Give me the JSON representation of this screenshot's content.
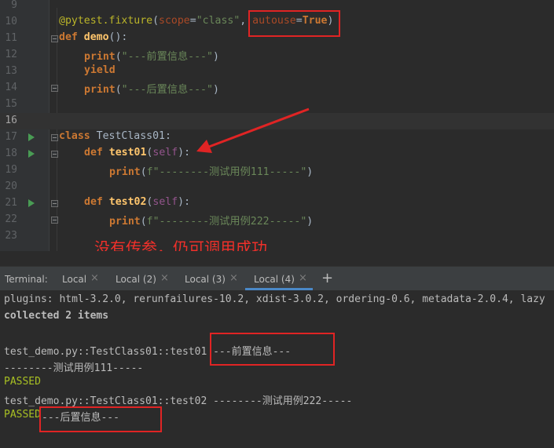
{
  "editor": {
    "lines": [
      {
        "num": "9"
      },
      {
        "num": "10",
        "dec": "@pytest.fixture",
        "p1": "(",
        "arg1": "scope",
        "eq1": "=",
        "s1": "\"class\"",
        "c1": ", ",
        "arg2": "autouse",
        "eq2": "=",
        "kwTrue": "True",
        "p2": ")"
      },
      {
        "num": "11",
        "kw": "def",
        "fn": "demo",
        "rest": "():"
      },
      {
        "num": "12",
        "kw": "print",
        "p1": "(",
        "str": "\"---前置信息---\"",
        "p2": ")"
      },
      {
        "num": "13",
        "kw": "yield"
      },
      {
        "num": "14",
        "kw": "print",
        "p1": "(",
        "str": "\"---后置信息---\"",
        "p2": ")"
      },
      {
        "num": "15"
      },
      {
        "num": "16"
      },
      {
        "num": "17",
        "kw": "class",
        "cls": " TestClass01:"
      },
      {
        "num": "18",
        "kw": "def",
        "fn": "test01",
        "p1": "(",
        "self": "self",
        "p2": "):"
      },
      {
        "num": "19",
        "kw": "print",
        "p1": "(",
        "str": "f\"--------测试用例111-----\"",
        "p2": ")"
      },
      {
        "num": "20"
      },
      {
        "num": "21",
        "kw": "def",
        "fn": "test02",
        "p1": "(",
        "self": "self",
        "p2": "):"
      },
      {
        "num": "22",
        "kw": "print",
        "p1": "(",
        "str": "f\"--------测试用例222-----\"",
        "p2": ")"
      },
      {
        "num": "23"
      }
    ],
    "annotation": "没有传参，仍可调用成功"
  },
  "terminal": {
    "label": "Terminal:",
    "tabs": [
      {
        "label": "Local",
        "close": "×"
      },
      {
        "label": "Local (2)",
        "close": "×"
      },
      {
        "label": "Local (3)",
        "close": "×"
      },
      {
        "label": "Local (4)",
        "close": "×"
      }
    ],
    "add": "+",
    "output": [
      "plugins: html-3.2.0, rerunfailures-10.2, xdist-3.0.2, ordering-0.6, metadata-2.0.4, lazy",
      "collected 2 items",
      "",
      "test_demo.py::TestClass01::test01 ---前置信息---",
      "--------测试用例111-----",
      "PASSED",
      "test_demo.py::TestClass01::test02 --------测试用例222-----",
      "PASSED",
      "---后置信息---"
    ]
  },
  "colors": {
    "background": "#2b2b2b",
    "annotation_red": "#e02424",
    "passed_green": "#a8c023",
    "run_green": "#499c54"
  }
}
